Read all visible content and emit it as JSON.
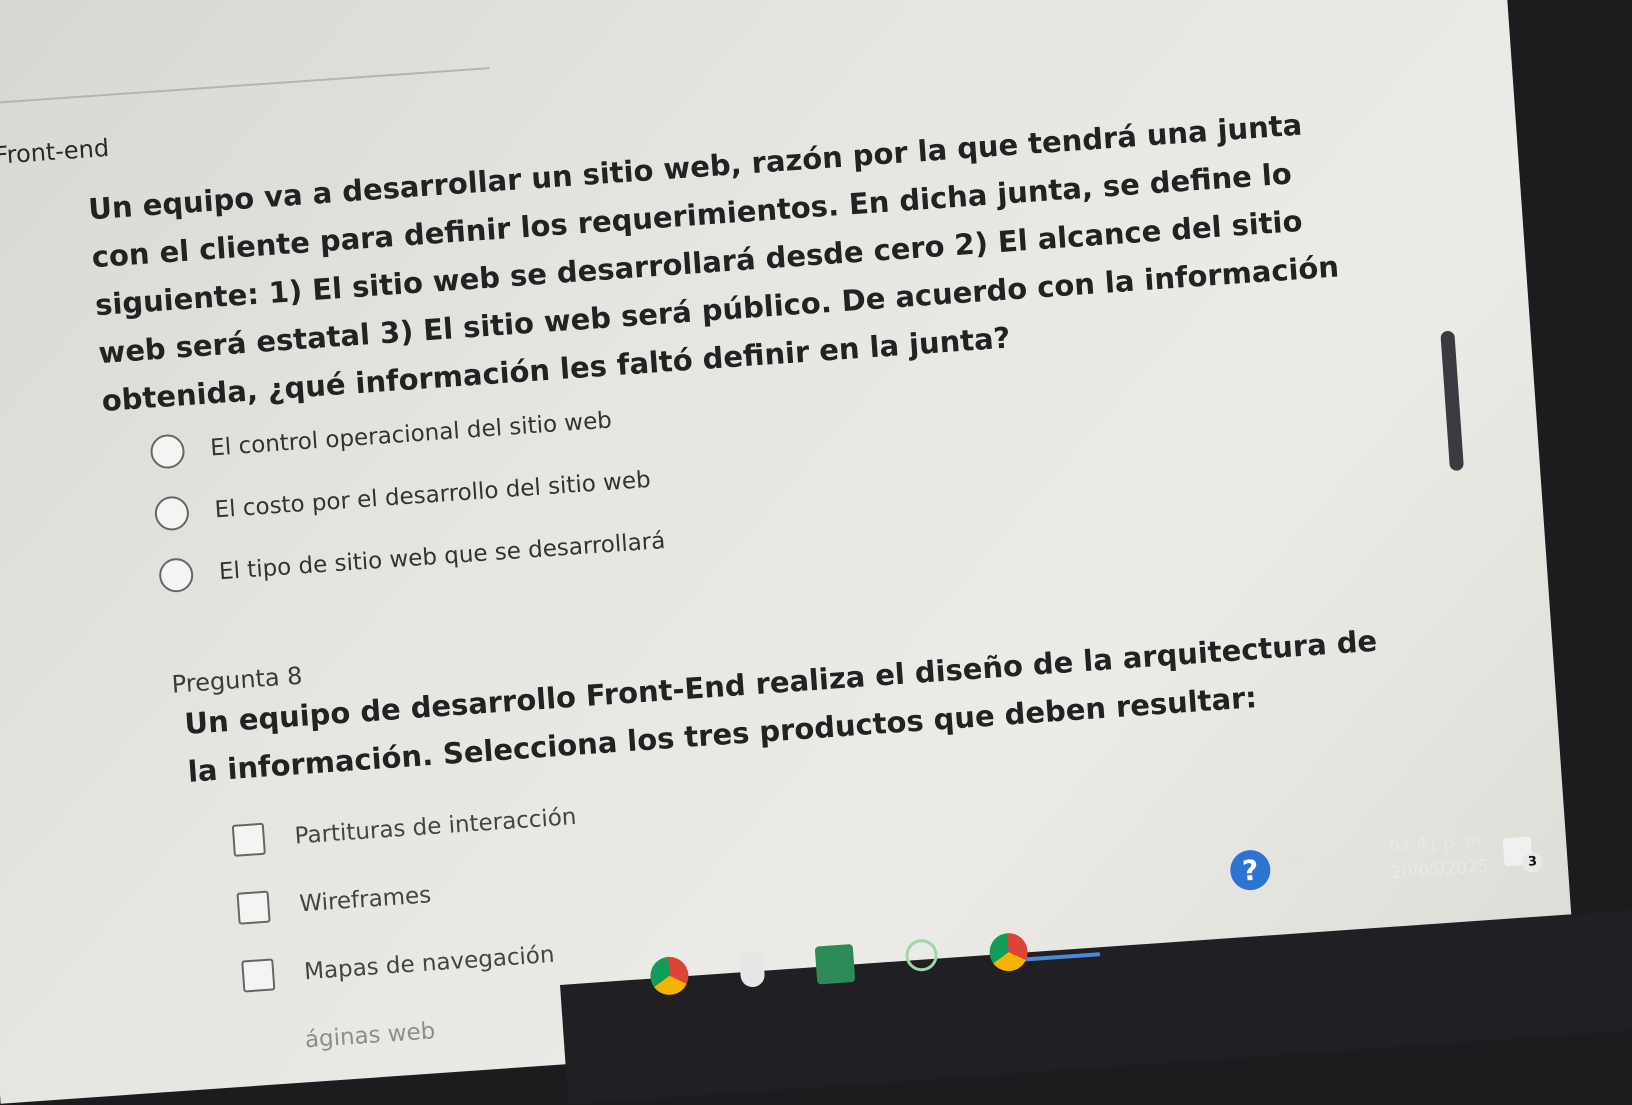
{
  "page": {
    "section_header": "or Front-end"
  },
  "question_7": {
    "text": "Un equipo va a desarrollar un sitio web, razón por la que tendrá una junta con el cliente para definir los requerimientos. En dicha junta, se define lo siguiente: 1) El sitio web se desarrollará desde cero 2) El alcance del sitio web será estatal 3) El sitio web será público. De acuerdo con la información obtenida, ¿qué información les faltó definir en la junta?",
    "options": [
      "El control operacional del sitio web",
      "El costo por el desarrollo del sitio web",
      "El tipo de sitio web que se desarrollará"
    ]
  },
  "question_8": {
    "title": "Pregunta 8",
    "text": "Un equipo de desarrollo Front-End realiza el diseño de la arquitectura de la información. Selecciona los tres productos que deben resultar:",
    "options": [
      "Partituras de interacción",
      "Wireframes",
      "Mapas de navegación",
      "áginas web"
    ]
  },
  "taskbar": {
    "time": "04:41 p. m.",
    "date": "20/05/2025",
    "notification_count": "3",
    "help_glyph": "?",
    "chevron_glyph": "^"
  }
}
